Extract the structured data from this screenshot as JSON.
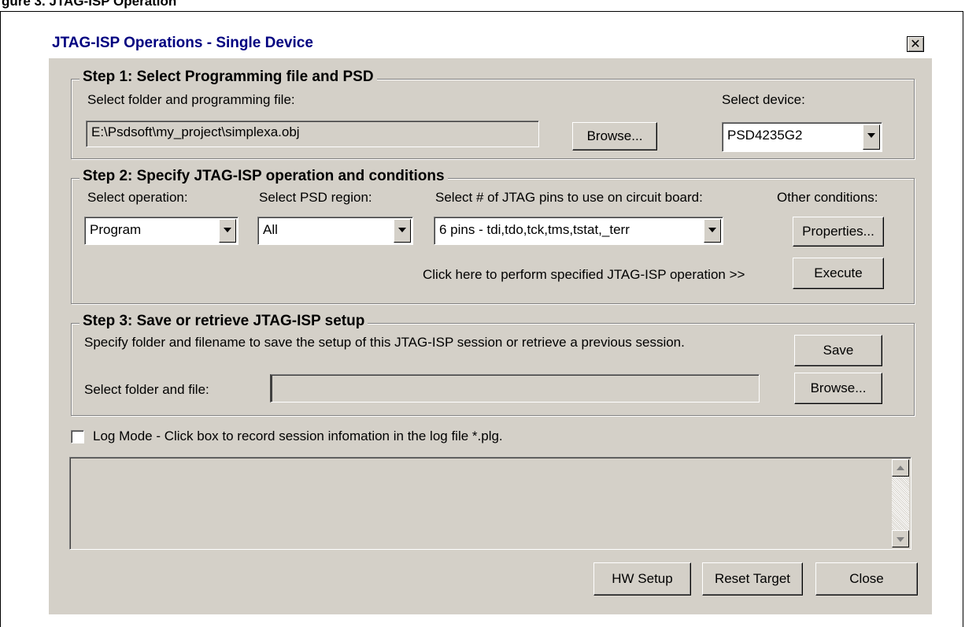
{
  "figure_caption": "gure 3. JTAG-ISP Operation",
  "window": {
    "title": "JTAG-ISP Operations - Single Device",
    "close_icon": "close-icon"
  },
  "step1": {
    "legend": "Step 1: Select Programming file and PSD",
    "file_label": "Select folder and programming file:",
    "file_value": "E:\\Psdsoft\\my_project\\simplexa.obj",
    "browse_label": "Browse...",
    "device_label": "Select device:",
    "device_value": "PSD4235G2"
  },
  "step2": {
    "legend": "Step 2: Specify JTAG-ISP operation and conditions",
    "operation_label": "Select operation:",
    "operation_value": "Program",
    "region_label": "Select PSD region:",
    "region_value": "All",
    "pins_label": "Select # of JTAG pins to use on circuit board:",
    "pins_value": "6 pins - tdi,tdo,tck,tms,tstat,_terr",
    "other_label": "Other conditions:",
    "properties_label": "Properties...",
    "execute_hint": "Click here to perform specified JTAG-ISP operation >>",
    "execute_label": "Execute"
  },
  "step3": {
    "legend": "Step 3: Save or retrieve JTAG-ISP setup",
    "description": "Specify folder and filename to save the setup of this JTAG-ISP session or retrieve a previous session.",
    "save_label": "Save",
    "file_label": "Select folder and file:",
    "file_value": "",
    "browse_label": "Browse..."
  },
  "log": {
    "checkbox_label": "Log Mode - Click box to record session infomation in the log file *.plg.",
    "checked": false
  },
  "footer": {
    "hw_setup_label": "HW Setup",
    "reset_target_label": "Reset Target",
    "close_label": "Close"
  }
}
